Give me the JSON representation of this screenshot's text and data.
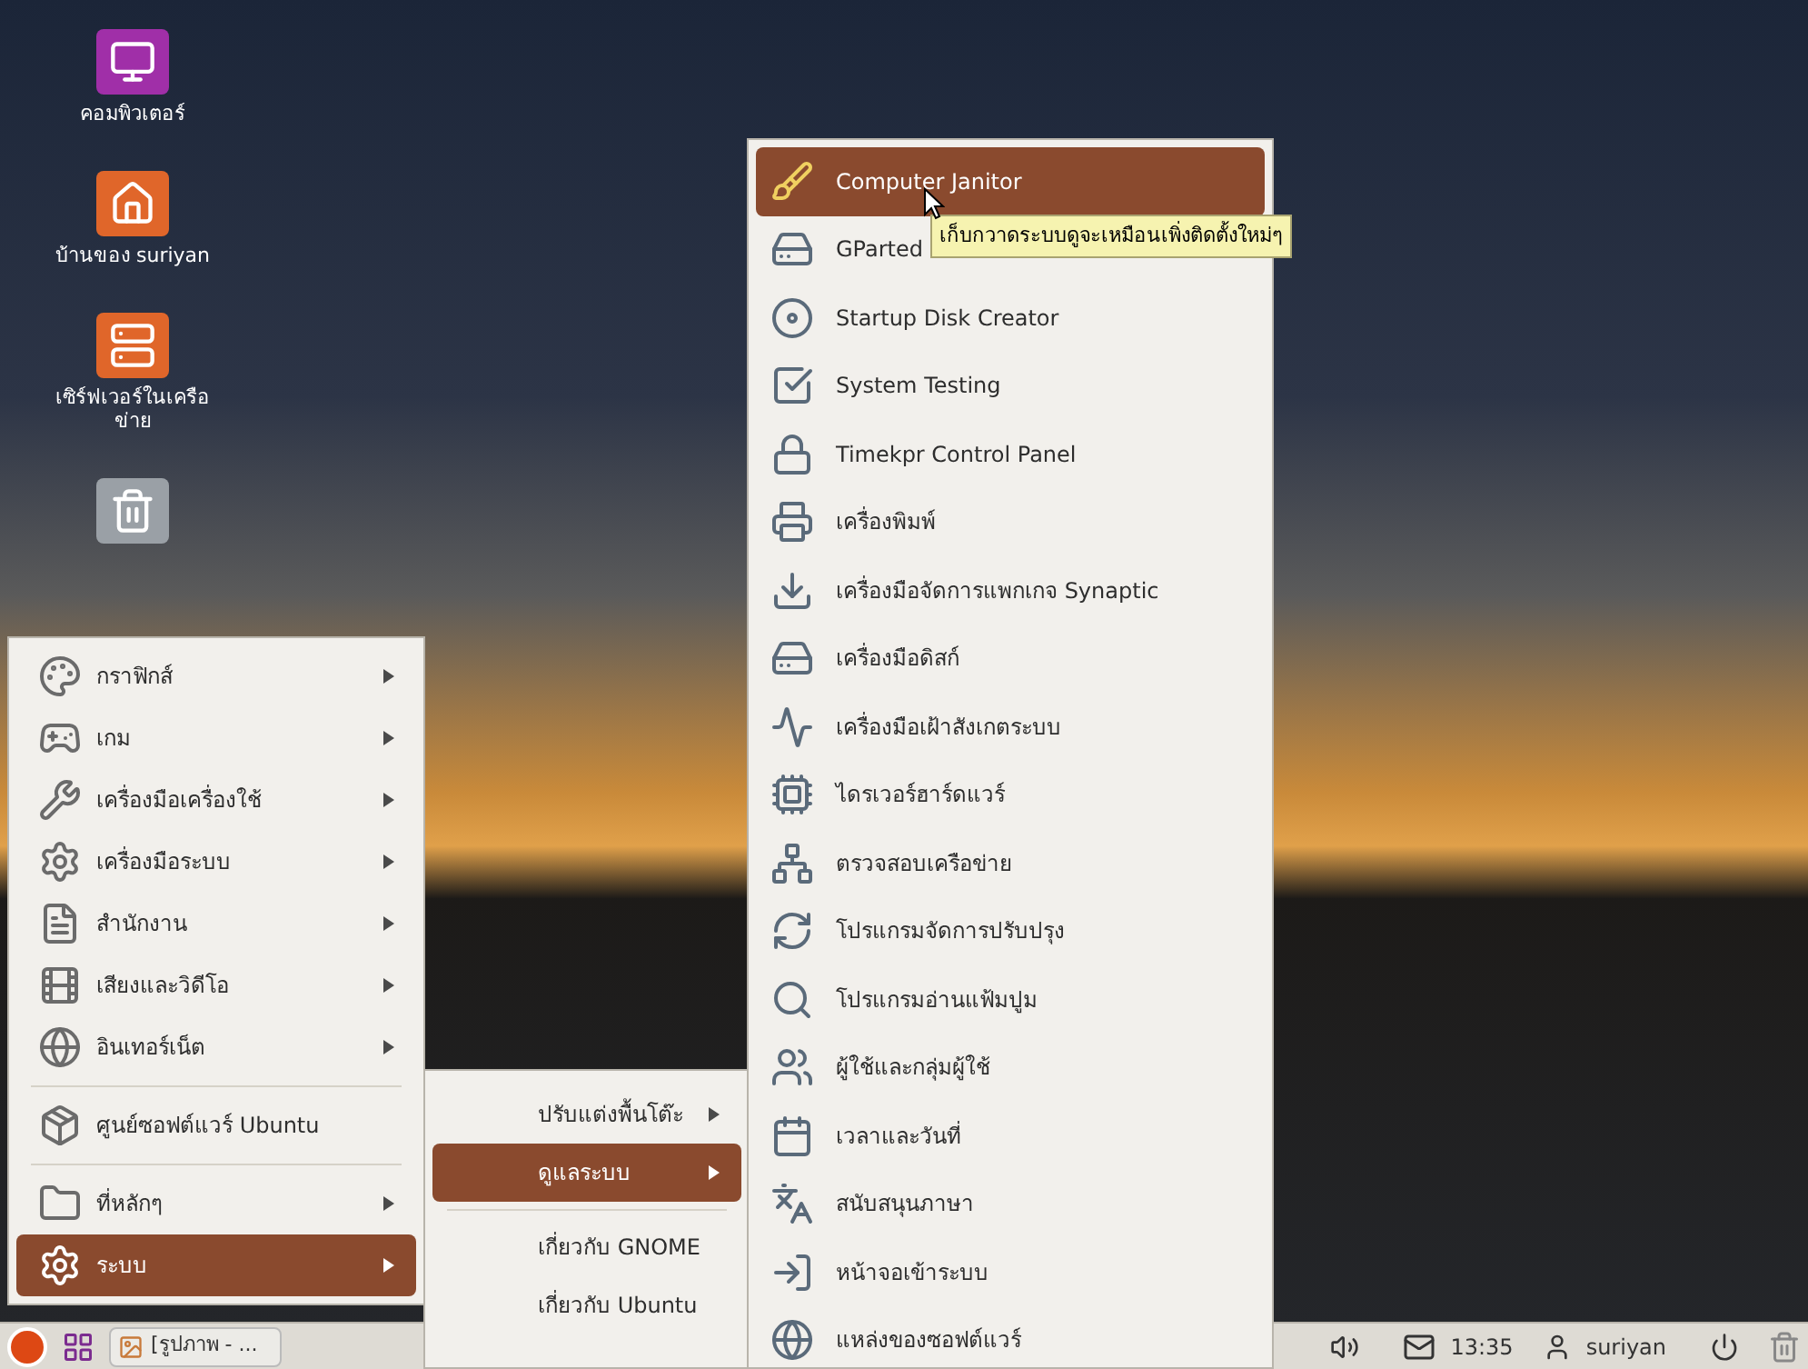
{
  "desktop_icons": [
    {
      "label": "คอมพิวเตอร์",
      "kind": "computer"
    },
    {
      "label": "บ้านของ suriyan",
      "kind": "home"
    },
    {
      "label": "เซิร์ฟเวอร์ในเครือข่าย",
      "kind": "network"
    },
    {
      "kind": "trash"
    }
  ],
  "main_menu": [
    {
      "kind": "item",
      "label": "กราฟิกส์",
      "submenu": true,
      "selected": false
    },
    {
      "kind": "item",
      "label": "เกม",
      "submenu": true,
      "selected": false
    },
    {
      "kind": "item",
      "label": "เครื่องมือเครื่องใช้",
      "submenu": true,
      "selected": false
    },
    {
      "kind": "item",
      "label": "เครื่องมือระบบ",
      "submenu": true,
      "selected": false
    },
    {
      "kind": "item",
      "label": "สำนักงาน",
      "submenu": true,
      "selected": false
    },
    {
      "kind": "item",
      "label": "เสียงและวิดีโอ",
      "submenu": true,
      "selected": false
    },
    {
      "kind": "item",
      "label": "อินเทอร์เน็ต",
      "submenu": true,
      "selected": false
    },
    {
      "kind": "separator"
    },
    {
      "kind": "item",
      "label": "ศูนย์ซอฟต์แวร์ Ubuntu",
      "submenu": false,
      "selected": false
    },
    {
      "kind": "separator"
    },
    {
      "kind": "item",
      "label": "ที่หลักๆ",
      "submenu": true,
      "selected": false
    },
    {
      "kind": "item",
      "label": "ระบบ",
      "submenu": true,
      "selected": true
    }
  ],
  "system_menu": [
    {
      "kind": "item",
      "label": "ปรับแต่งพื้นโต๊ะ",
      "submenu": true,
      "selected": false
    },
    {
      "kind": "item",
      "label": "ดูแลระบบ",
      "submenu": true,
      "selected": true
    },
    {
      "kind": "separator"
    },
    {
      "kind": "item",
      "label": "เกี่ยวกับ GNOME",
      "submenu": false,
      "selected": false
    },
    {
      "kind": "item",
      "label": "เกี่ยวกับ Ubuntu",
      "submenu": false,
      "selected": false
    }
  ],
  "admin_menu": [
    {
      "label": "Computer Janitor",
      "selected": true
    },
    {
      "label": "GParted",
      "selected": false
    },
    {
      "label": "Startup Disk Creator",
      "selected": false
    },
    {
      "label": "System Testing",
      "selected": false
    },
    {
      "label": "Timekpr Control Panel",
      "selected": false
    },
    {
      "label": "เครื่องพิมพ์",
      "selected": false
    },
    {
      "label": "เครื่องมือจัดการแพกเกจ Synaptic",
      "selected": false
    },
    {
      "label": "เครื่องมือดิสก์",
      "selected": false
    },
    {
      "label": "เครื่องมือเฝ้าสังเกตระบบ",
      "selected": false
    },
    {
      "label": "ไดรเวอร์ฮาร์ดแวร์",
      "selected": false
    },
    {
      "label": "ตรวจสอบเครือข่าย",
      "selected": false
    },
    {
      "label": "โปรแกรมจัดการปรับปรุง",
      "selected": false
    },
    {
      "label": "โปรแกรมอ่านแฟ้มปูม",
      "selected": false
    },
    {
      "label": "ผู้ใช้และกลุ่มผู้ใช้",
      "selected": false
    },
    {
      "label": "เวลาและวันที่",
      "selected": false
    },
    {
      "label": "สนับสนุนภาษา",
      "selected": false
    },
    {
      "label": "หน้าจอเข้าระบบ",
      "selected": false
    },
    {
      "label": "แหล่งของซอฟต์แวร์",
      "selected": false
    }
  ],
  "tooltip": "เก็บกวาดระบบดูจะเหมือนเพิ่งติดตั้งใหม่ๆ",
  "taskbar": {
    "task": "[รูปภาพ - ...",
    "clock": "13:35",
    "user": "suriyan"
  }
}
